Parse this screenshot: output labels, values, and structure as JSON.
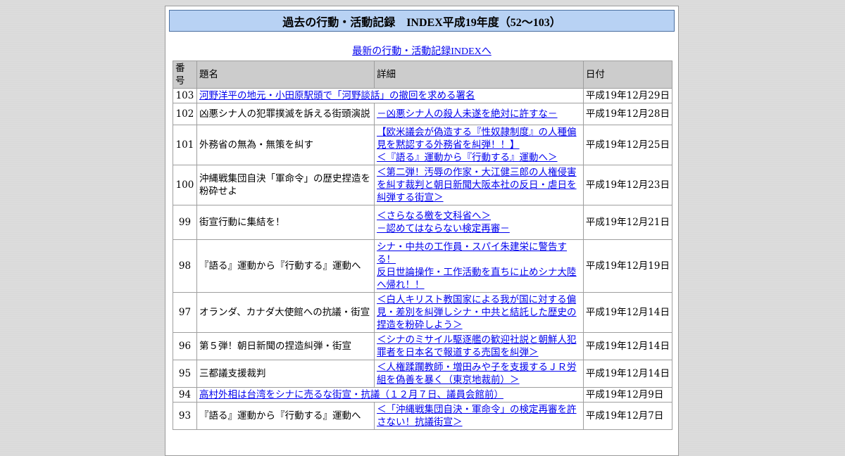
{
  "page": {
    "title": "過去の行動・活動記録　INDEX平成19年度（52～103）",
    "latest_link": "最新の行動・活動記録INDEXへ"
  },
  "table": {
    "headers": [
      "番号",
      "題名",
      "詳細",
      "日付"
    ],
    "rows": [
      {
        "num": "103",
        "title": "河野洋平の地元・小田原駅頭で「河野談話」の撤回を求める署名",
        "title_is_link": true,
        "details": [],
        "date": "平成19年12月29日"
      },
      {
        "num": "102",
        "title": "凶悪シナ人の犯罪撲滅を訴える街頭演説",
        "title_is_link": false,
        "details": [
          "－凶悪シナ人の殺人未遂を絶対に許すな－"
        ],
        "date": "平成19年12月28日"
      },
      {
        "num": "101",
        "title": "外務省の無為・無策を糾す",
        "title_is_link": false,
        "details": [
          "【欧米議会が偽造する『性奴隷制度』の人種偏見を黙認する外務省を糾弾！！】",
          "＜『語る』運動から『行動する』運動へ＞"
        ],
        "date": "平成19年12月25日"
      },
      {
        "num": "100",
        "title": "沖縄戦集団自決「軍命令」の歴史捏造を粉砕せよ",
        "title_is_link": false,
        "details": [
          "＜第二弾！汚辱の作家・大江健三郎の人権侵害を糾す裁判と朝日新聞大阪本社の反日・虐日を糾弾する街宣＞"
        ],
        "date": "平成19年12月23日"
      },
      {
        "num": "99",
        "title": "街宣行動に集結を！",
        "title_is_link": false,
        "details": [
          "＜さらなる檄を文科省へ＞",
          "－認めてはならない検定再審－"
        ],
        "date": "平成19年12月21日"
      },
      {
        "num": "98",
        "title": "『語る』運動から『行動する』運動へ",
        "title_is_link": false,
        "details": [
          "シナ・中共の工作員・スパイ朱建栄に警告する！",
          "反日世論操作・工作活動を直ちに止めシナ大陸へ帰れ！！"
        ],
        "date": "平成19年12月19日"
      },
      {
        "num": "97",
        "title": "オランダ、カナダ大使館への抗議・街宣",
        "title_is_link": false,
        "details": [
          "＜白人キリスト教国家による我が国に対する偏見・差別を糾弾しシナ・中共と結託した歴史の捏造を粉砕しよう＞"
        ],
        "date": "平成19年12月14日"
      },
      {
        "num": "96",
        "title": "第５弾！朝日新聞の捏造糾弾・街宣",
        "title_is_link": false,
        "details": [
          "＜シナのミサイル駆逐艦の歓迎社説と朝鮮人犯罪者を日本名で報道する売国を糾弾＞"
        ],
        "date": "平成19年12月14日"
      },
      {
        "num": "95",
        "title": "三都議支援裁判",
        "title_is_link": false,
        "details": [
          "＜人権蹂躙教師・増田みや子を支援するＪＲ労組を偽善を暴く（東京地裁前）＞"
        ],
        "date": "平成19年12月14日"
      },
      {
        "num": "94",
        "title": "高村外相は台湾をシナに売るな街宣・抗議（１２月７日、議員会館前）",
        "title_is_link": true,
        "details": [],
        "date": "平成19年12月9日"
      },
      {
        "num": "93",
        "title": "『語る』運動から『行動する』運動へ",
        "title_is_link": false,
        "details": [
          "＜「沖縄戦集団自決・軍命令」の検定再審を許さない！抗議街宣＞"
        ],
        "date": "平成19年12月7日"
      }
    ]
  }
}
